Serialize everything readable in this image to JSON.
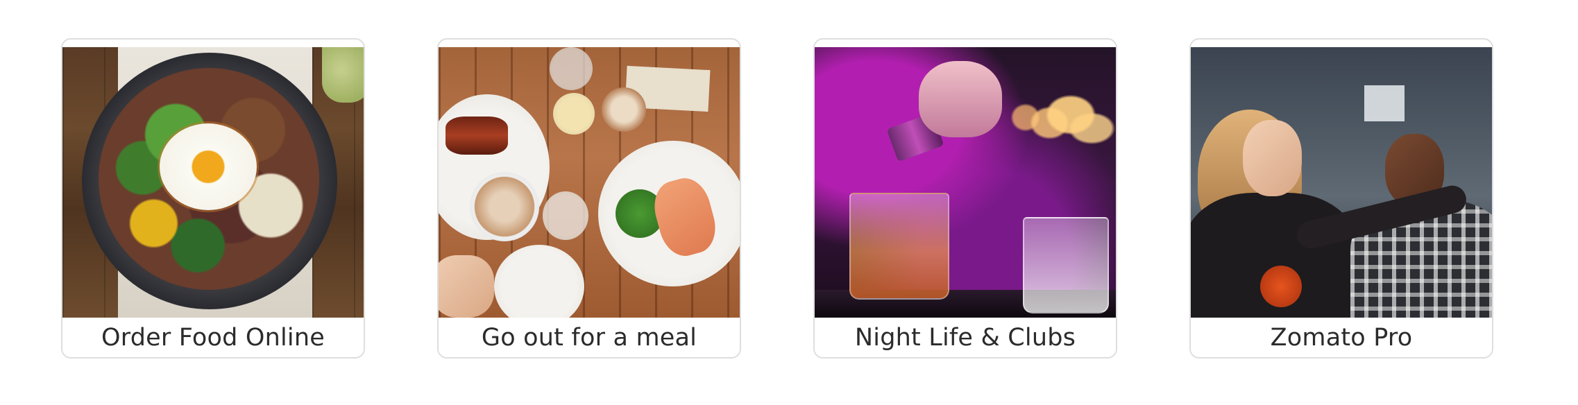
{
  "cards": [
    {
      "label": "Order Food Online",
      "image_alt": "bowl of food"
    },
    {
      "label": "Go out for a meal",
      "image_alt": "brunch table"
    },
    {
      "label": "Night Life & Clubs",
      "image_alt": "bartender pouring drink"
    },
    {
      "label": "Zomato Pro",
      "image_alt": "friends toasting"
    }
  ],
  "colors": {
    "card_border": "#dedede",
    "label_text": "#2b2b2b",
    "background": "#ffffff"
  }
}
